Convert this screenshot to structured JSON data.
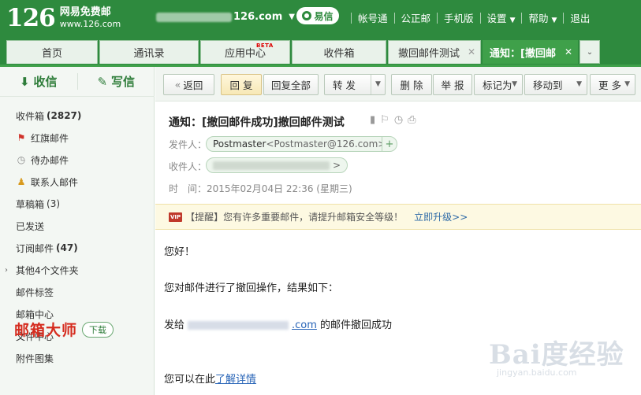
{
  "header": {
    "logo_number": "126",
    "logo_name": "网易免费邮",
    "logo_url": "www.126.com",
    "account_suffix": "126.com",
    "yixin_label": "易信",
    "links": [
      "帐号通",
      "公正邮",
      "手机版",
      "设置",
      "帮助",
      "退出"
    ]
  },
  "tabs": [
    {
      "label": "首页"
    },
    {
      "label": "通讯录"
    },
    {
      "label": "应用中心",
      "badge": "BETA"
    },
    {
      "label": "收件箱"
    },
    {
      "label": "撤回邮件测试"
    },
    {
      "label": "通知：[撤回邮",
      "active": true
    }
  ],
  "sidebar": {
    "receive_label": "收信",
    "write_label": "写信",
    "folders": [
      {
        "name": "收件箱",
        "count": "(2827)"
      },
      {
        "name": "红旗邮件",
        "icon": "flag-icon"
      },
      {
        "name": "待办邮件",
        "icon": "clock-icon"
      },
      {
        "name": "联系人邮件",
        "icon": "contact-icon"
      },
      {
        "name": "草稿箱",
        "count": "(3)"
      },
      {
        "name": "已发送"
      },
      {
        "name": "订阅邮件",
        "count": "(47)"
      },
      {
        "name": "其他4个文件夹"
      },
      {
        "name": "邮件标签"
      },
      {
        "name": "邮箱中心"
      },
      {
        "name": "文件中心"
      },
      {
        "name": "附件图集"
      }
    ],
    "promo_text": "邮箱大师",
    "promo_button": "下载"
  },
  "toolbar": {
    "back": "返回",
    "reply": "回 复",
    "reply_all": "回复全部",
    "forward": "转 发",
    "delete": "删 除",
    "report": "举 报",
    "mark_as": "标记为",
    "move_to": "移动到",
    "more": "更 多"
  },
  "mail": {
    "subject": "通知：[撤回邮件成功]撤回邮件测试",
    "from_label": "发件人：",
    "from_name": "Postmaster",
    "from_addr": "<Postmaster@126.com>",
    "to_label": "收件人：",
    "time_label": "时　间：",
    "time_value": "2015年02月04日 22:36 (星期三)"
  },
  "notice": {
    "vip": "VIP",
    "text": "【提醒】您有许多重要邮件，请提升邮箱安全等级！",
    "link": "立即升级>>"
  },
  "body": {
    "greeting": "您好！",
    "line1": "您对邮件进行了撤回操作，结果如下：",
    "line2_prefix": "发给",
    "line2_domain": ".com",
    "line2_suffix": " 的邮件撤回成功",
    "line3_prefix": "您可以在此",
    "line3_link": "了解详情"
  },
  "watermark": {
    "main": "Bai度经验",
    "sub": "jingyan.baidu.com"
  },
  "colors": {
    "brand_green": "#2e8a3e",
    "tab_active": "#3fa04a",
    "link_blue": "#2a66b8",
    "promo_red": "#d52b1e"
  }
}
